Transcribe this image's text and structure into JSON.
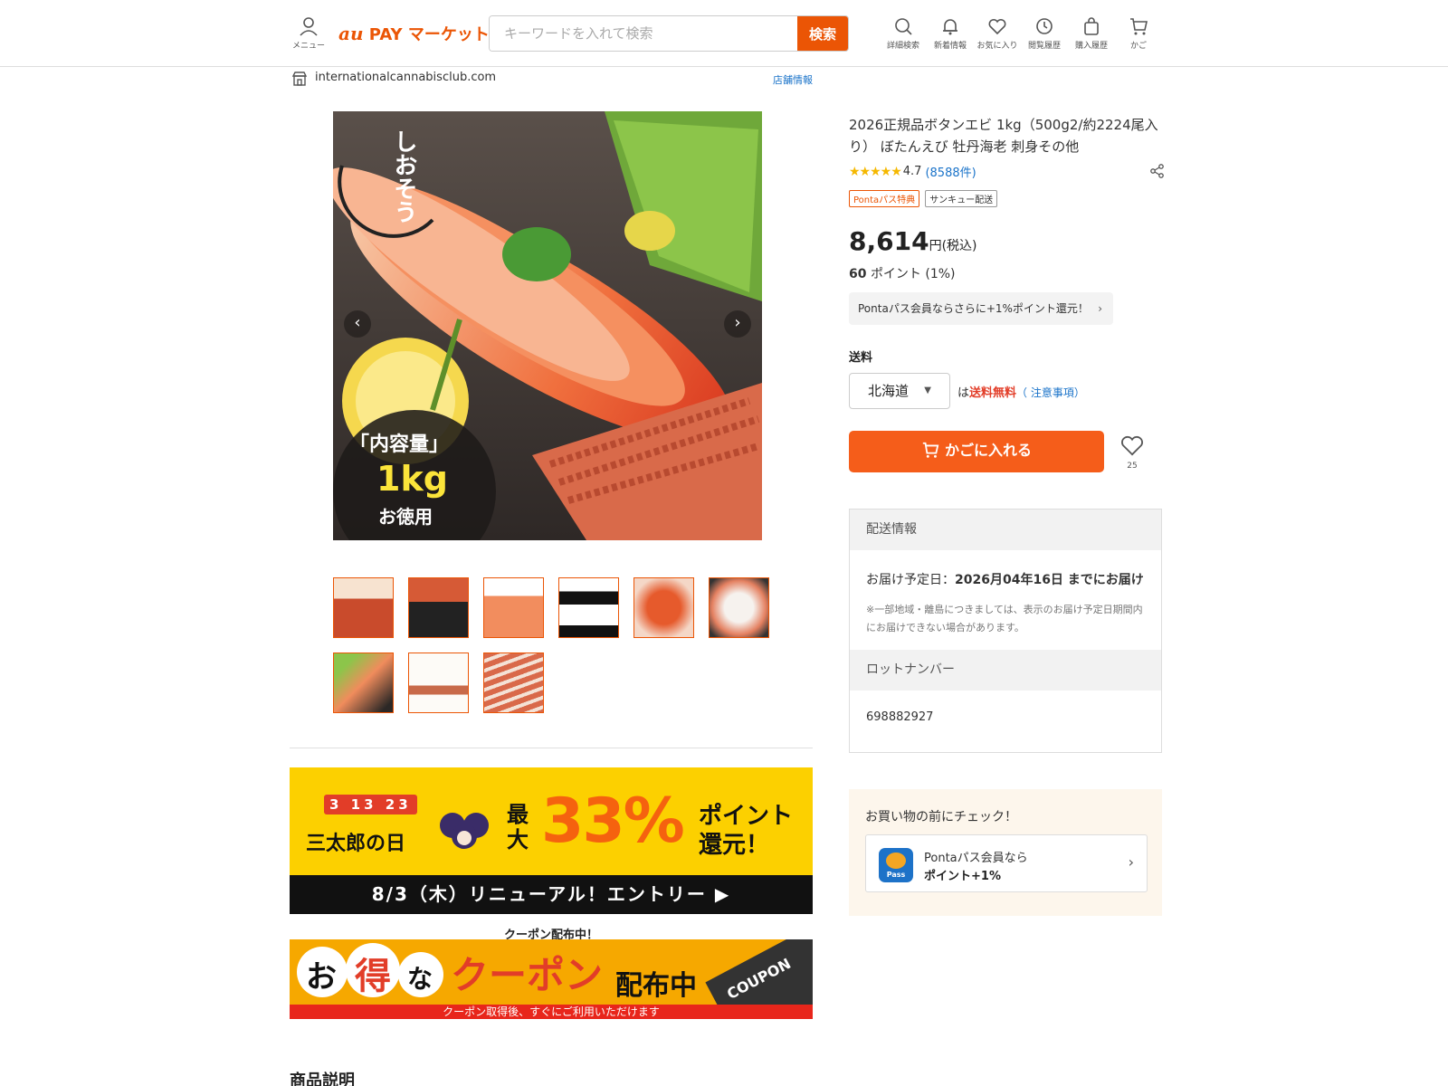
{
  "header": {
    "menu_label": "メニュー",
    "logo_au": "au",
    "logo_text": "PAY マーケット",
    "search_placeholder": "キーワードを入れて検索",
    "search_button": "検索",
    "icons": [
      {
        "name": "search-icon",
        "label": "詳細検索"
      },
      {
        "name": "bell-icon",
        "label": "新着情報"
      },
      {
        "name": "heart-icon",
        "label": "お気に入り"
      },
      {
        "name": "history-icon",
        "label": "閲覧履歴"
      },
      {
        "name": "bag-icon",
        "label": "購入履歴"
      },
      {
        "name": "cart-icon",
        "label": "かご"
      }
    ]
  },
  "shop": {
    "name": "internationalcannabisclub.com",
    "info_link": "店舗情報"
  },
  "gallery": {
    "overlay_top": "しおそう",
    "overlay_label": "「内容量」",
    "overlay_weight": "1kg",
    "overlay_sub": "お徳用",
    "nav_prev": "‹",
    "nav_next": "›",
    "thumb_count": 9
  },
  "banners": {
    "b1_date_label": "3 13 23",
    "b1_title": "三太郎の日",
    "b1_max": "最大",
    "b1_percent": "33%",
    "b1_point": "ポイント還元！",
    "b1_bottom": "8/3（木）リニューアル！エントリー ▶",
    "coupon_caption": "クーポン配布中！",
    "b2_text1": "お",
    "b2_text2": "得",
    "b2_text3": "な",
    "b2_text4": "クーポン",
    "b2_text5": "配布中",
    "b2_coupon": "COUPON",
    "b2_strip": "クーポン取得後、すぐにご利用いただけます"
  },
  "description_title": "商品説明",
  "product": {
    "title": "2026正規品ボタンエビ 1kg（500g2/約2224尾入り） ぼたんえび 牡丹海老 刺身その他",
    "stars": "★★★★★",
    "rating": "4.7",
    "review_count": "(8588件)",
    "badge_ponta": "Pontaパス特典",
    "badge_thanks": "サンキュー配送",
    "price": "8,614",
    "price_unit": "円(税込)",
    "points_value": "60",
    "points_text": "ポイント (1%)",
    "ponta_banner": "Pontaパス会員ならさらに+1%ポイント還元！",
    "shipping_label": "送料",
    "region": "北海道",
    "free_prefix": "は",
    "free_text": "送料無料",
    "notice_link": "（ 注意事項）",
    "cart_button": "かごに入れる",
    "fav_count": "25"
  },
  "delivery": {
    "header": "配送情報",
    "date_prefix": "お届け予定日：",
    "date": "2026月04年16日 までにお届け",
    "note": "※一部地域・離島につきましては、表示のお届け予定日期間内にお届けできない場合があります。",
    "lot_header": "ロットナンバー",
    "lot_number": "698882927"
  },
  "check": {
    "title": "お買い物の前にチェック！",
    "line1": "Pontaパス会員なら",
    "line2": "ポイント+1%",
    "pass_label": "Pass"
  },
  "colors": {
    "brand": "#eb5505",
    "cart": "#f55d1a",
    "link": "#1a73c9"
  }
}
